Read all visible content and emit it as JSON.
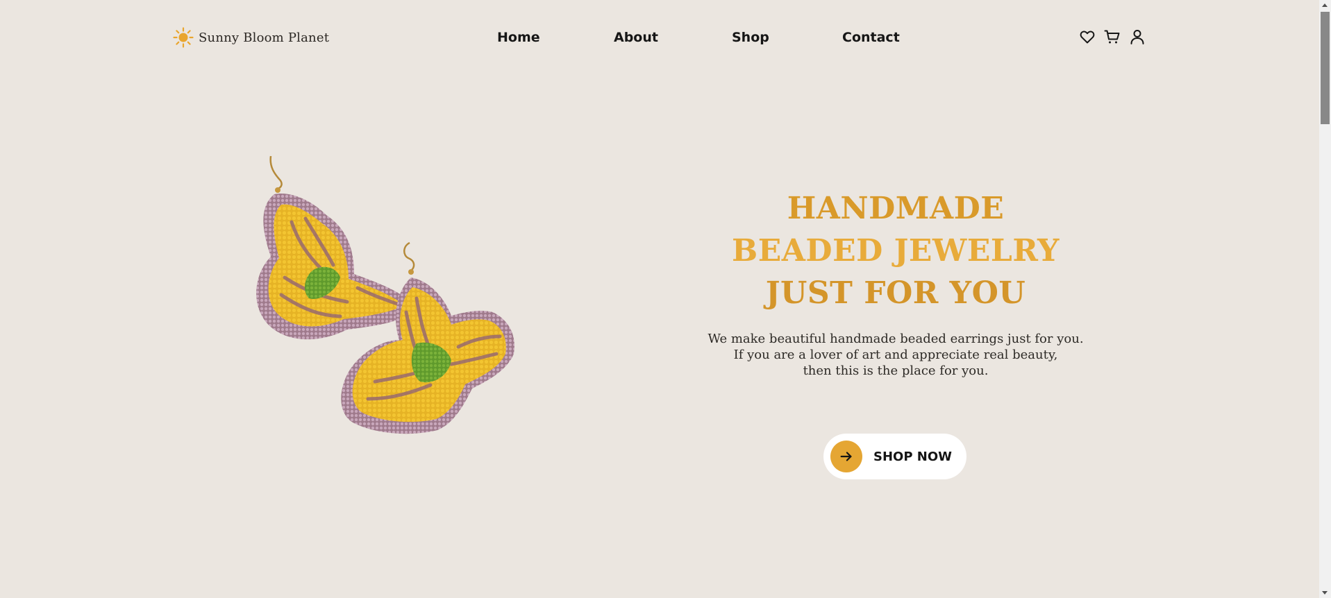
{
  "header": {
    "brand_name": "Sunny Bloom Planet",
    "logo_icon": "sun-icon",
    "nav": {
      "home": "Home",
      "about": "About",
      "shop": "Shop",
      "contact": "Contact"
    },
    "icons": [
      "heart-icon",
      "cart-icon",
      "user-icon"
    ]
  },
  "hero": {
    "title_lines": [
      "HANDMADE",
      "BEADED JEWELRY",
      "JUST FOR YOU"
    ],
    "description_lines": [
      "We make beautiful handmade beaded earrings just for you.",
      "If you are a lover of art and appreciate real beauty,",
      "then this is the place for you."
    ],
    "cta_label": "SHOP NOW",
    "cta_icon": "arrow-right-icon",
    "image": "butterfly-earrings-image"
  },
  "colors": {
    "background": "#ebe6e0",
    "accent": "#e5a633",
    "title": "#e2a230",
    "text": "#2d2a26",
    "button_bg": "#ffffff"
  }
}
